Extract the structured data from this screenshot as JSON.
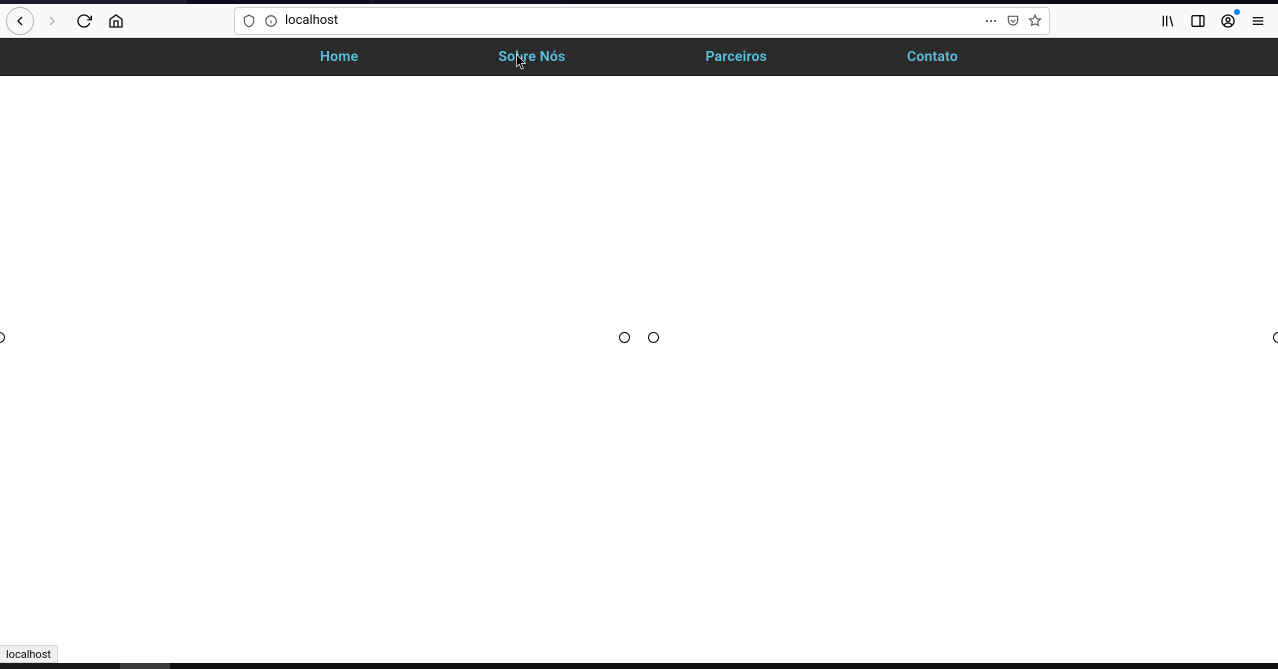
{
  "browser": {
    "url": "localhost",
    "status_text": "localhost"
  },
  "nav": {
    "items": [
      {
        "label": "Home"
      },
      {
        "label": "Sobre Nós"
      },
      {
        "label": "Parceiros"
      },
      {
        "label": "Contato"
      }
    ]
  }
}
